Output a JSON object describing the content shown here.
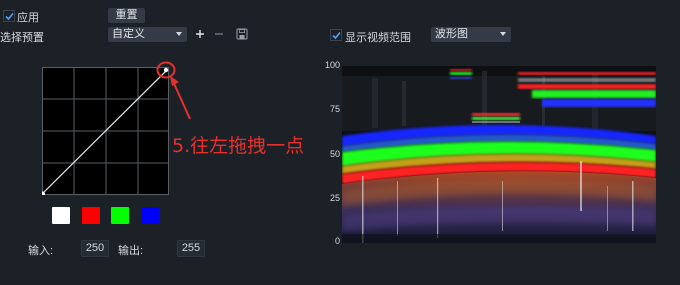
{
  "header": {
    "apply_label": "应用",
    "apply_checked": true,
    "reset_label": "重置",
    "preset_label": "选择预置",
    "preset_value": "自定义"
  },
  "curve": {
    "input_label": "输入:",
    "input_value": "250",
    "output_label": "输出:",
    "output_value": "255"
  },
  "channels": [
    {
      "name": "white",
      "color": "#ffffff"
    },
    {
      "name": "red",
      "color": "#ff0000"
    },
    {
      "name": "green",
      "color": "#00ff00"
    },
    {
      "name": "blue",
      "color": "#0000ff"
    }
  ],
  "annotation": {
    "text": "5.往左拖拽一点",
    "color": "#e8302a"
  },
  "scope": {
    "show_range_label": "显示视频范围",
    "show_range_checked": true,
    "mode_value": "波形图",
    "axis_ticks": [
      "100",
      "75",
      "50",
      "25",
      "0"
    ]
  },
  "colors": {
    "background": "#1c2128",
    "control": "#343b46",
    "accent": "#3b8de0",
    "annotation": "#e8302a"
  }
}
